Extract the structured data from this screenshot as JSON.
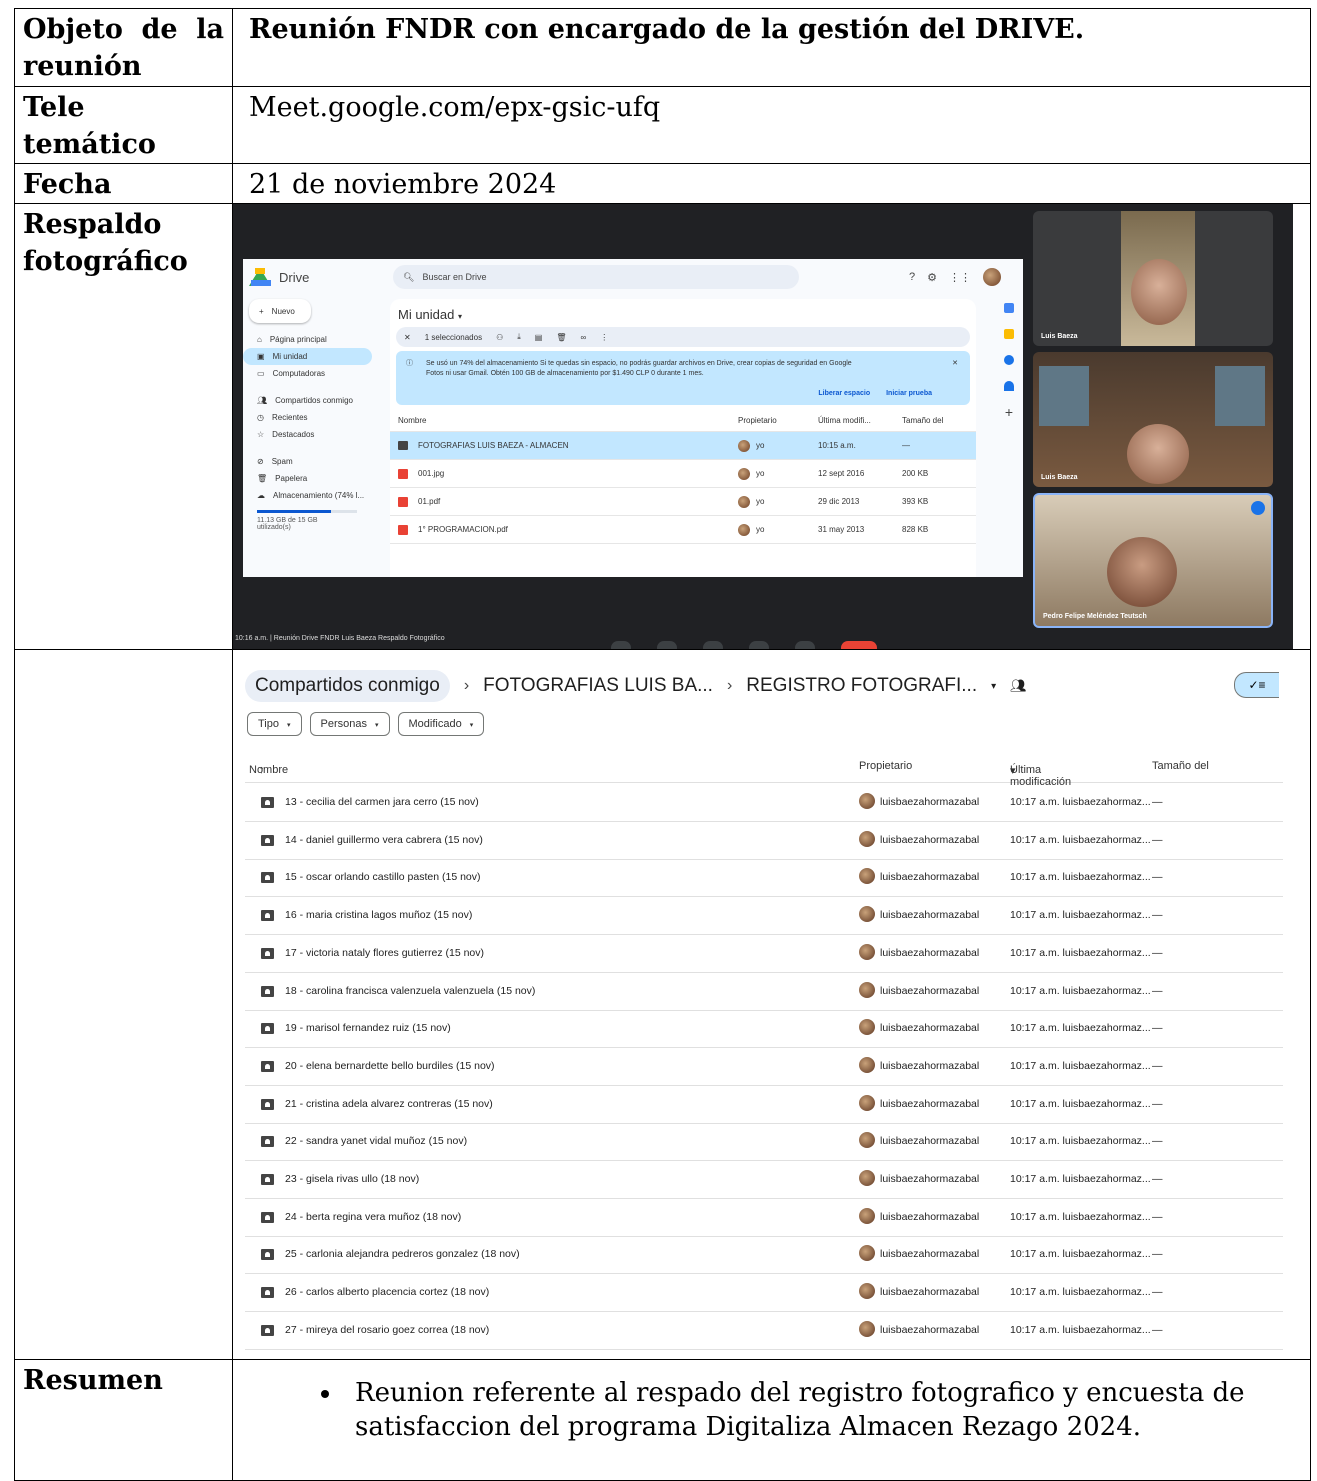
{
  "table": {
    "rows": [
      {
        "label": "Objeto de la reunión",
        "value": "Reunión FNDR con encargado de la gestión del DRIVE."
      },
      {
        "label": "Tele temático",
        "value": "Meet.google.com/epx-gsic-ufq"
      },
      {
        "label": "Fecha",
        "value": "21 de noviembre 2024"
      },
      {
        "label": "Respaldo fotográfico"
      },
      {
        "label": "Resumen"
      }
    ],
    "summary_items": [
      "Reunion referente al respado del registro fotografico y encuesta de satisfaccion del programa Digitaliza Almacen Rezago 2024."
    ]
  },
  "drive_meet": {
    "app_title": "Drive",
    "search_placeholder": "Buscar en Drive",
    "new_button": "Nuevo",
    "sidebar": [
      "Página principal",
      "Mi unidad",
      "Computadoras",
      "Compartidos conmigo",
      "Recientes",
      "Destacados",
      "Spam",
      "Papelera",
      "Almacenamiento (74% l..."
    ],
    "storage_text": "11.13 GB de 15 GB utilizado(s)",
    "folder_title": "Mi unidad",
    "selection": "1 seleccionados",
    "banner_line1": "Se usó un 74% del almacenamiento Si te quedas sin espacio, no podrás guardar archivos en Drive, crear copias de seguridad en Google",
    "banner_line2": "Fotos ni usar Gmail. Obtén 100 GB de almacenamiento por $1.490 CLP 0 durante 1 mes.",
    "banner_actions": [
      "Liberar espacio",
      "Iniciar prueba"
    ],
    "columns": [
      "Nombre",
      "Propietario",
      "Última modifi...",
      "Tamaño del"
    ],
    "files": [
      {
        "name": "FOTOGRAFIAS LUIS BAEZA - ALMACEN",
        "owner": "yo",
        "modified": "10:15 a.m.",
        "size": "—",
        "type": "folder"
      },
      {
        "name": "001.jpg",
        "owner": "yo",
        "modified": "12 sept 2016",
        "size": "200 KB",
        "type": "img"
      },
      {
        "name": "01.pdf",
        "owner": "yo",
        "modified": "29 dic 2013",
        "size": "393 KB",
        "type": "pdf"
      },
      {
        "name": "1° PROGRAMACION.pdf",
        "owner": "yo",
        "modified": "31 may 2013",
        "size": "828 KB",
        "type": "pdf"
      }
    ],
    "participants": [
      "Luis Baeza",
      "Luis Baeza",
      "Pedro Felipe Meléndez Teutsch"
    ],
    "meeting_bar": "10:16 a.m. | Reunión Drive FNDR Luis Baeza Respaldo Fotográfico"
  },
  "shared_folder": {
    "breadcrumb": [
      "Compartidos conmigo",
      "FOTOGRAFIAS LUIS BA...",
      "REGISTRO FOTOGRAFI..."
    ],
    "filters": [
      "Tipo",
      "Personas",
      "Modificado"
    ],
    "columns": [
      "Nombre",
      "Propietario",
      "Última modificación",
      "Tamaño del"
    ],
    "rows": [
      "13 - cecilia del carmen jara cerro (15 nov)",
      "14 - daniel guillermo vera cabrera (15 nov)",
      "15 - oscar orlando castillo pasten (15 nov)",
      "16 - maria cristina lagos muñoz (15 nov)",
      "17 - victoria nataly flores gutierrez (15 nov)",
      "18 - carolina francisca valenzuela valenzuela (15 nov)",
      "19 - marisol fernandez ruiz (15 nov)",
      "20 - elena bernardette bello burdiles (15 nov)",
      "21 - cristina adela alvarez contreras (15 nov)",
      "22 - sandra yanet vidal muñoz (15 nov)",
      "23 - gisela rivas ullo (18 nov)",
      "24 - berta regina vera muñoz (18 nov)",
      "25 - carlonia alejandra pedreros gonzalez (18 nov)",
      "26 - carlos alberto placencia cortez (18 nov)",
      "27 - mireya del rosario goez correa (18 nov)"
    ],
    "owner": "luisbaezahormazabal",
    "modified": "10:17 a.m. luisbaezahormaz...",
    "size": "—"
  }
}
